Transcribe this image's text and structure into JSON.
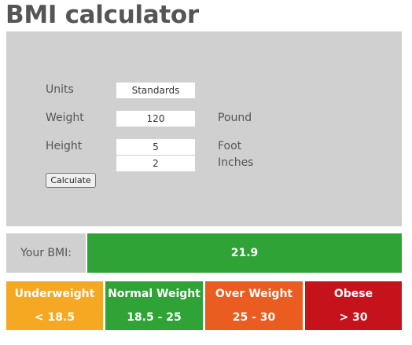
{
  "title": "BMI calculator",
  "form": {
    "units_label": "Units",
    "units_value": "Standards",
    "weight_label": "Weight",
    "weight_value": "120",
    "weight_unit": "Pound",
    "height_label": "Height",
    "height_feet_value": "5",
    "height_feet_unit": "Foot",
    "height_inches_value": "2",
    "height_inches_unit": "Inches",
    "calculate_label": "Calculate"
  },
  "result": {
    "label": "Your BMI:",
    "value": "21.9",
    "color": "#2fa335"
  },
  "categories": [
    {
      "name": "Underweight",
      "range": "< 18.5",
      "color": "#f7a823"
    },
    {
      "name": "Normal Weight",
      "range": "18.5 - 25",
      "color": "#2fa335"
    },
    {
      "name": "Over Weight",
      "range": "25 - 30",
      "color": "#ea5c20"
    },
    {
      "name": "Obese",
      "range": "> 30",
      "color": "#c5121b"
    }
  ]
}
